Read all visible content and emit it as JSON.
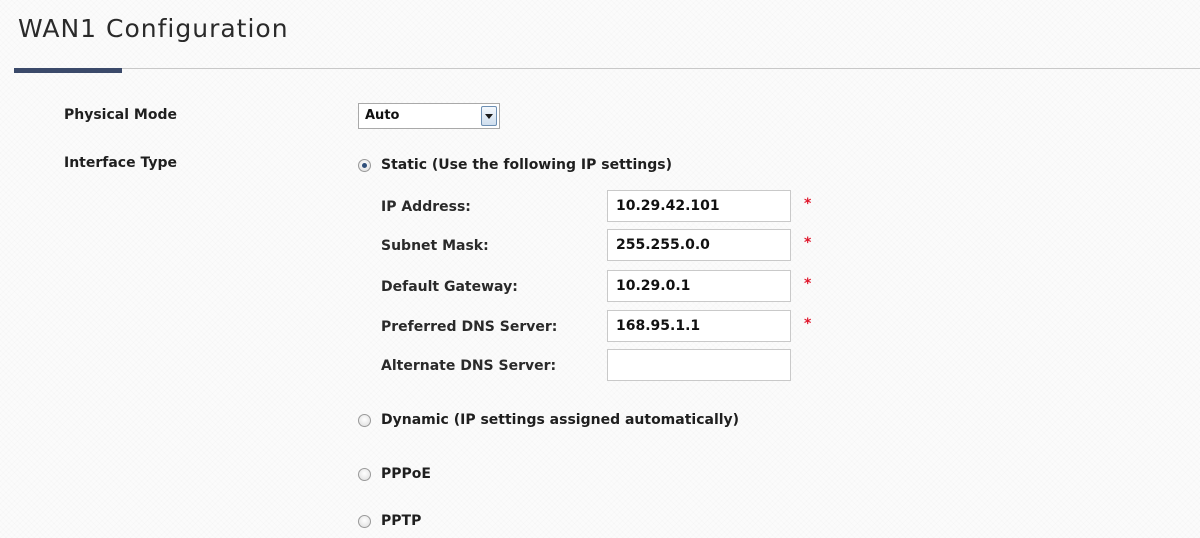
{
  "page": {
    "title": "WAN1 Configuration"
  },
  "physical_mode": {
    "label": "Physical Mode",
    "selected": "Auto"
  },
  "interface_type": {
    "label": "Interface Type",
    "options": [
      {
        "label": "Static (Use the following IP settings)",
        "checked": true
      },
      {
        "label": "Dynamic (IP settings assigned automatically)",
        "checked": false
      },
      {
        "label": "PPPoE",
        "checked": false
      },
      {
        "label": "PPTP",
        "checked": false
      }
    ]
  },
  "static_fields": [
    {
      "label": "IP Address:",
      "value": "10.29.42.101",
      "required": true
    },
    {
      "label": "Subnet Mask:",
      "value": "255.255.0.0",
      "required": true
    },
    {
      "label": "Default Gateway:",
      "value": "10.29.0.1",
      "required": true
    },
    {
      "label": "Preferred DNS Server:",
      "value": "168.95.1.1",
      "required": true
    },
    {
      "label": "Alternate DNS Server:",
      "value": "",
      "required": false
    }
  ],
  "required_marker": "*",
  "colors": {
    "accent": "#3b4a6a",
    "required": "#e0162b"
  },
  "icons": {
    "select_arrow": "chevron-down-icon"
  }
}
